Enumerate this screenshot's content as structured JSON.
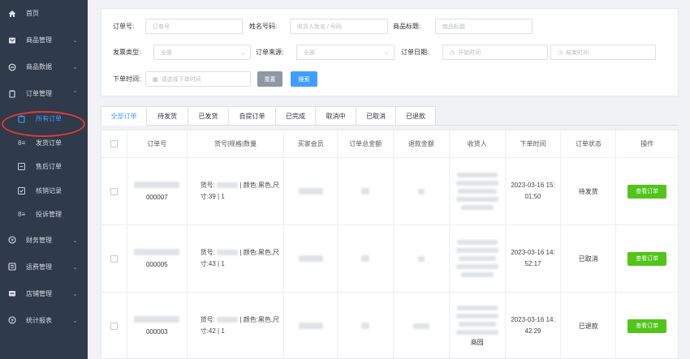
{
  "sidebar": {
    "items": [
      {
        "label": "首页",
        "icon": "home-icon",
        "has_children": false
      },
      {
        "label": "商品管理",
        "icon": "product-icon",
        "has_children": true
      },
      {
        "label": "商品数据",
        "icon": "data-icon",
        "has_children": true
      },
      {
        "label": "订单管理",
        "icon": "order-icon",
        "has_children": true,
        "expanded": true
      }
    ],
    "subitems": [
      {
        "label": "所有订单",
        "icon": "all-orders-icon",
        "active": true
      },
      {
        "label": "发货订单",
        "icon": "ship-orders-icon",
        "active": false
      },
      {
        "label": "售后订单",
        "icon": "after-sale-icon",
        "active": false
      },
      {
        "label": "核销记录",
        "icon": "verify-record-icon",
        "active": false
      },
      {
        "label": "投诉管理",
        "icon": "complaint-icon",
        "active": false
      }
    ],
    "items2": [
      {
        "label": "财务管理",
        "icon": "finance-icon"
      },
      {
        "label": "运费管理",
        "icon": "freight-icon"
      },
      {
        "label": "店铺管理",
        "icon": "store-icon"
      },
      {
        "label": "统计报表",
        "icon": "report-icon"
      }
    ]
  },
  "filters": {
    "order_no": {
      "label": "订单号:",
      "placeholder": "订单号"
    },
    "name_phone": {
      "label": "姓名号码:",
      "placeholder": "收货人姓名 / 号码"
    },
    "product_title": {
      "label": "商品标题:",
      "placeholder": "商品标题"
    },
    "invoice_type": {
      "label": "发票类型:",
      "value": "全部"
    },
    "order_source": {
      "label": "订单来源:",
      "value": "全部"
    },
    "order_date": {
      "label": "订单日期:",
      "start": "开始时间",
      "end": "结束时间"
    },
    "order_time": {
      "label": "下单时间:",
      "placeholder": "请选择下单时间"
    },
    "reset_label": "重置",
    "search_label": "搜索"
  },
  "tabs": [
    "全部订单",
    "待发货",
    "已发货",
    "自提订单",
    "已完成",
    "取消中",
    "已取消",
    "已退款"
  ],
  "table": {
    "headers": [
      "订单号",
      "货号|规格|数量",
      "买家会员",
      "订单总金额",
      "退款金额",
      "收货人",
      "下单时间",
      "订单状态",
      "操作"
    ],
    "rows": [
      {
        "order_no_suffix": "000007",
        "goods_prefix": "货号:",
        "goods_spec": "| 颜色:黑色,尺",
        "goods_size": "寸:39 | 1",
        "time_line1": "2023-03-16 15:",
        "time_line2": "01:50",
        "status": "待发货",
        "action": "查看订单",
        "receiver_extra": ""
      },
      {
        "order_no_suffix": "000005",
        "goods_prefix": "货号:",
        "goods_spec": "| 颜色:黑色,尺",
        "goods_size": "寸:43 | 1",
        "time_line1": "2023-03-16 14:",
        "time_line2": "52:17",
        "status": "已取消",
        "action": "查看订单",
        "receiver_extra": ""
      },
      {
        "order_no_suffix": "000003",
        "goods_prefix": "货号:",
        "goods_spec": "| 颜色:黑色,尺",
        "goods_size": "寸:42 | 1",
        "time_line1": "2023-03-16 14:",
        "time_line2": "42:29",
        "status": "已退款",
        "action": "查看订单",
        "receiver_extra": "商园"
      }
    ]
  },
  "colors": {
    "sidebar_bg": "#2f3a4b",
    "accent": "#409eff",
    "view_button": "#52c41a",
    "highlight_ring": "#e23a2e"
  }
}
